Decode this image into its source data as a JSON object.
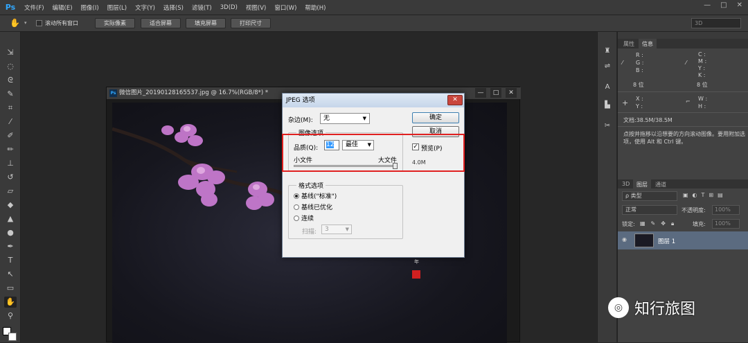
{
  "menubar": {
    "logo": "Ps",
    "items": [
      "文件(F)",
      "编辑(E)",
      "图像(I)",
      "图层(L)",
      "文字(Y)",
      "选择(S)",
      "滤镜(T)",
      "3D(D)",
      "视图(V)",
      "窗口(W)",
      "帮助(H)"
    ],
    "window_controls": [
      "—",
      "□",
      "✕"
    ]
  },
  "options_bar": {
    "scroll_all_label": "滚动所有窗口",
    "buttons": [
      "实际像素",
      "适合屏幕",
      "填充屏幕",
      "打印尺寸"
    ],
    "workspace_select": "3D"
  },
  "document": {
    "logo": "Ps",
    "title": "微信图片_20190128165537.jpg @ 16.7%(RGB/8*) *",
    "controls": [
      "—",
      "□",
      "✕"
    ],
    "seal_text": "年"
  },
  "dialog": {
    "title": "JPEG 选项",
    "close": "✕",
    "matte_label": "杂边(M):",
    "matte_value": "无",
    "ok": "确定",
    "cancel": "取消",
    "image_options_label": "图像选项",
    "quality_label": "品质(Q):",
    "quality_value": "12",
    "quality_preset": "最佳",
    "small_file": "小文件",
    "large_file": "大文件",
    "quality_slider_fraction": 1.0,
    "preview_label": "预览(P)",
    "preview_checked": true,
    "file_size": "4.0M",
    "format_options_label": "格式选项",
    "formats": [
      {
        "label": "基线(\"标准\")",
        "selected": true
      },
      {
        "label": "基线已优化",
        "selected": false
      },
      {
        "label": "连续",
        "selected": false
      }
    ],
    "scans_label": "扫描:",
    "scans_value": "3"
  },
  "panels": {
    "info_tabs": [
      "属性",
      "信息"
    ],
    "info": {
      "rgb": [
        "R :",
        "G :",
        "B :"
      ],
      "cmyk": [
        "C :",
        "M :",
        "Y :",
        "K :"
      ],
      "bits_left": "8 位",
      "bits_right": "8 位",
      "xy": [
        "X :",
        "Y :"
      ],
      "wh": [
        "W :",
        "H :"
      ],
      "doc": "文档:38.5M/38.5M",
      "hint": "点按并拖移以沿想要的方向滚动图像。要用附加选项，使用 Alt 和 Ctrl 键。"
    },
    "layer_tabs": [
      "3D",
      "图层",
      "通道"
    ],
    "kind_label": "ρ 类型",
    "blend_mode": "正常",
    "opacity_label": "不透明度:",
    "opacity_value": "100%",
    "lock_label": "锁定:",
    "fill_label": "填充:",
    "fill_value": "100%",
    "layer_name": "图层 1"
  },
  "watermark": {
    "text": "知行旅图"
  },
  "colors": {
    "highlight": "#e02020",
    "ps_blue": "#31a8ff",
    "blossom": "#c77ad0"
  }
}
